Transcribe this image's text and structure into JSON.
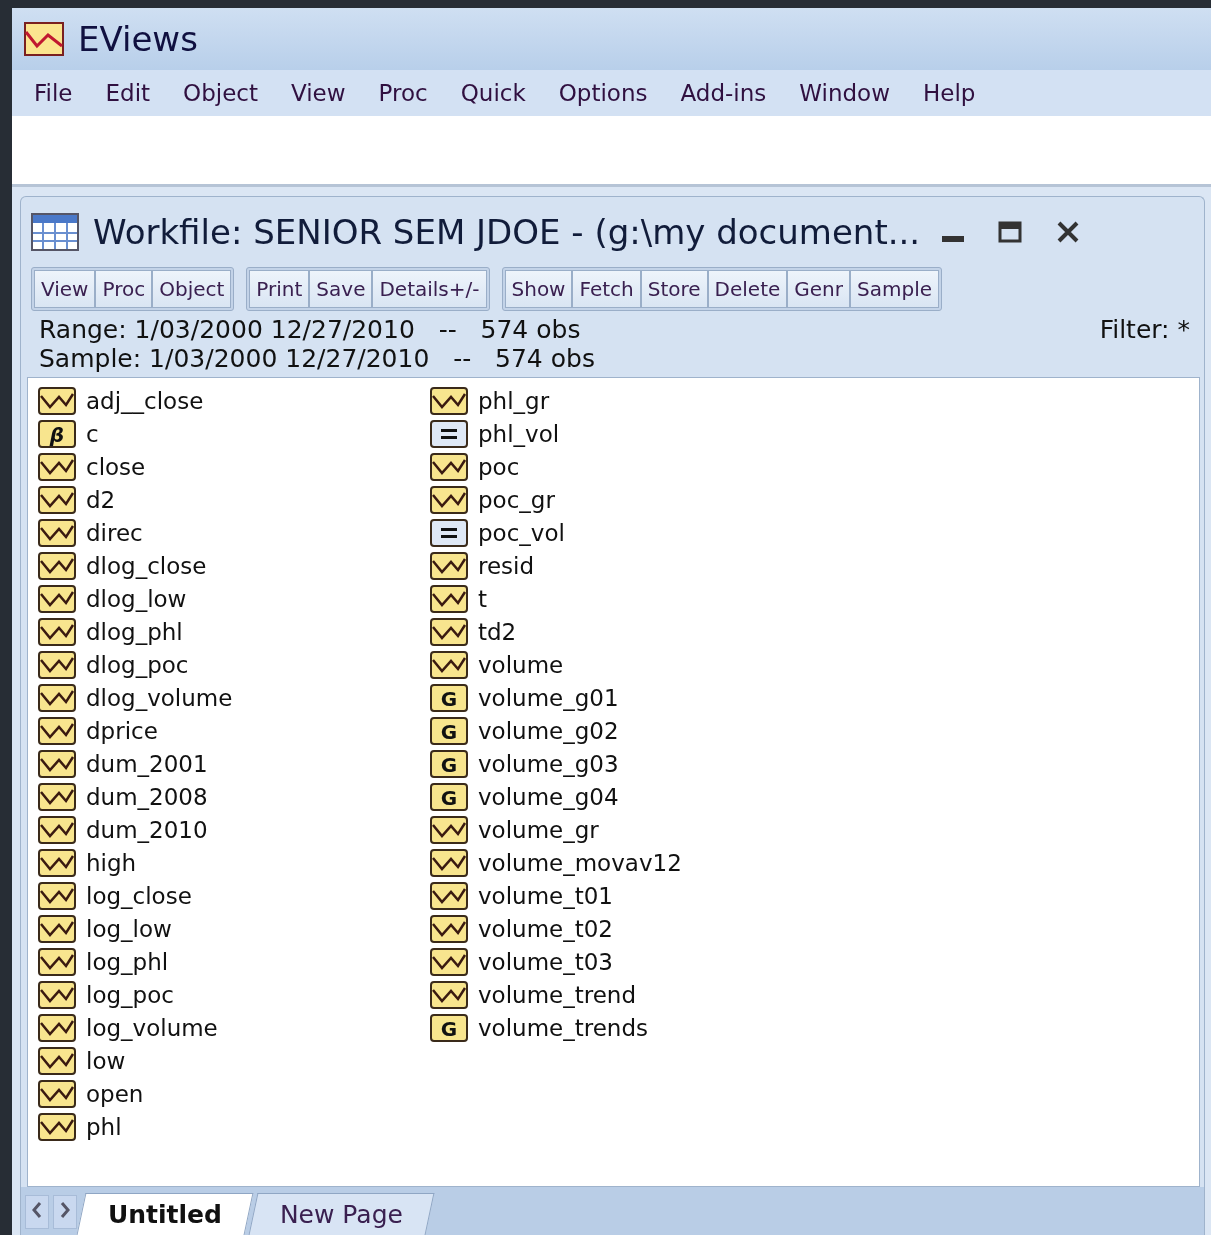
{
  "app": {
    "title": "EViews",
    "menu": [
      "File",
      "Edit",
      "Object",
      "View",
      "Proc",
      "Quick",
      "Options",
      "Add-ins",
      "Window",
      "Help"
    ]
  },
  "workfile": {
    "title": "Workfile: SENIOR SEM JDOE - (g:\\my document...",
    "toolbar": [
      [
        "View",
        "Proc",
        "Object"
      ],
      [
        "Print",
        "Save",
        "Details+/-"
      ],
      [
        "Show",
        "Fetch",
        "Store",
        "Delete",
        "Genr",
        "Sample"
      ]
    ],
    "range": {
      "label": "Range:",
      "value": "1/03/2000 12/27/2010",
      "sep": "--",
      "obs": "574 obs"
    },
    "sample": {
      "label": "Sample:",
      "value": "1/03/2000 12/27/2010",
      "sep": "--",
      "obs": "574 obs"
    },
    "filter": "Filter: *",
    "objects": [
      {
        "name": "adj__close",
        "kind": "series"
      },
      {
        "name": "c",
        "kind": "coef",
        "glyph": "β"
      },
      {
        "name": "close",
        "kind": "series"
      },
      {
        "name": "d2",
        "kind": "series"
      },
      {
        "name": "direc",
        "kind": "series"
      },
      {
        "name": "dlog_close",
        "kind": "series"
      },
      {
        "name": "dlog_low",
        "kind": "series"
      },
      {
        "name": "dlog_phl",
        "kind": "series"
      },
      {
        "name": "dlog_poc",
        "kind": "series"
      },
      {
        "name": "dlog_volume",
        "kind": "series"
      },
      {
        "name": "dprice",
        "kind": "series"
      },
      {
        "name": "dum_2001",
        "kind": "series"
      },
      {
        "name": "dum_2008",
        "kind": "series"
      },
      {
        "name": "dum_2010",
        "kind": "series"
      },
      {
        "name": "high",
        "kind": "series"
      },
      {
        "name": "log_close",
        "kind": "series"
      },
      {
        "name": "log_low",
        "kind": "series"
      },
      {
        "name": "log_phl",
        "kind": "series"
      },
      {
        "name": "log_poc",
        "kind": "series"
      },
      {
        "name": "log_volume",
        "kind": "series"
      },
      {
        "name": "low",
        "kind": "series"
      },
      {
        "name": "open",
        "kind": "series"
      },
      {
        "name": "phl",
        "kind": "series"
      },
      {
        "name": "phl_gr",
        "kind": "series"
      },
      {
        "name": "phl_vol",
        "kind": "equation"
      },
      {
        "name": "poc",
        "kind": "series"
      },
      {
        "name": "poc_gr",
        "kind": "series"
      },
      {
        "name": "poc_vol",
        "kind": "equation"
      },
      {
        "name": "resid",
        "kind": "series"
      },
      {
        "name": "t",
        "kind": "series"
      },
      {
        "name": "td2",
        "kind": "series"
      },
      {
        "name": "volume",
        "kind": "series"
      },
      {
        "name": "volume_g01",
        "kind": "group",
        "glyph": "G"
      },
      {
        "name": "volume_g02",
        "kind": "group",
        "glyph": "G"
      },
      {
        "name": "volume_g03",
        "kind": "group",
        "glyph": "G"
      },
      {
        "name": "volume_g04",
        "kind": "group",
        "glyph": "G"
      },
      {
        "name": "volume_gr",
        "kind": "series"
      },
      {
        "name": "volume_movav12",
        "kind": "series"
      },
      {
        "name": "volume_t01",
        "kind": "series"
      },
      {
        "name": "volume_t02",
        "kind": "series"
      },
      {
        "name": "volume_t03",
        "kind": "series"
      },
      {
        "name": "volume_trend",
        "kind": "series"
      },
      {
        "name": "volume_trends",
        "kind": "group",
        "glyph": "G"
      }
    ],
    "pages": [
      {
        "label": "Untitled",
        "selected": true
      },
      {
        "label": "New Page",
        "selected": false
      }
    ]
  }
}
